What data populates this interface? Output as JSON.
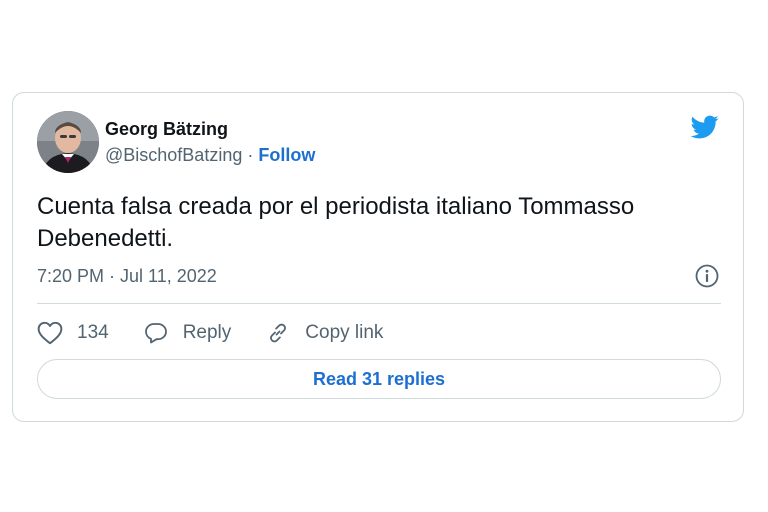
{
  "colors": {
    "accent": "#1d6fd2",
    "twitter_blue": "#1d9bf0",
    "secondary_text": "#536471",
    "border": "#cfd9de"
  },
  "tweet": {
    "author": {
      "name": "Georg Bätzing",
      "handle": "@BischofBatzing",
      "separator": "·",
      "follow_label": "Follow",
      "avatar_icon": "profile-photo"
    },
    "brand_icon": "twitter-bird-icon",
    "text": "Cuenta falsa creada por el periodista italiano Tommasso Debenedetti.",
    "timestamp": "7:20 PM · Jul 11, 2022",
    "info_icon": "info-icon",
    "actions": {
      "like_count": "134",
      "reply_label": "Reply",
      "copy_link_label": "Copy link"
    },
    "read_replies_label": "Read 31 replies"
  }
}
